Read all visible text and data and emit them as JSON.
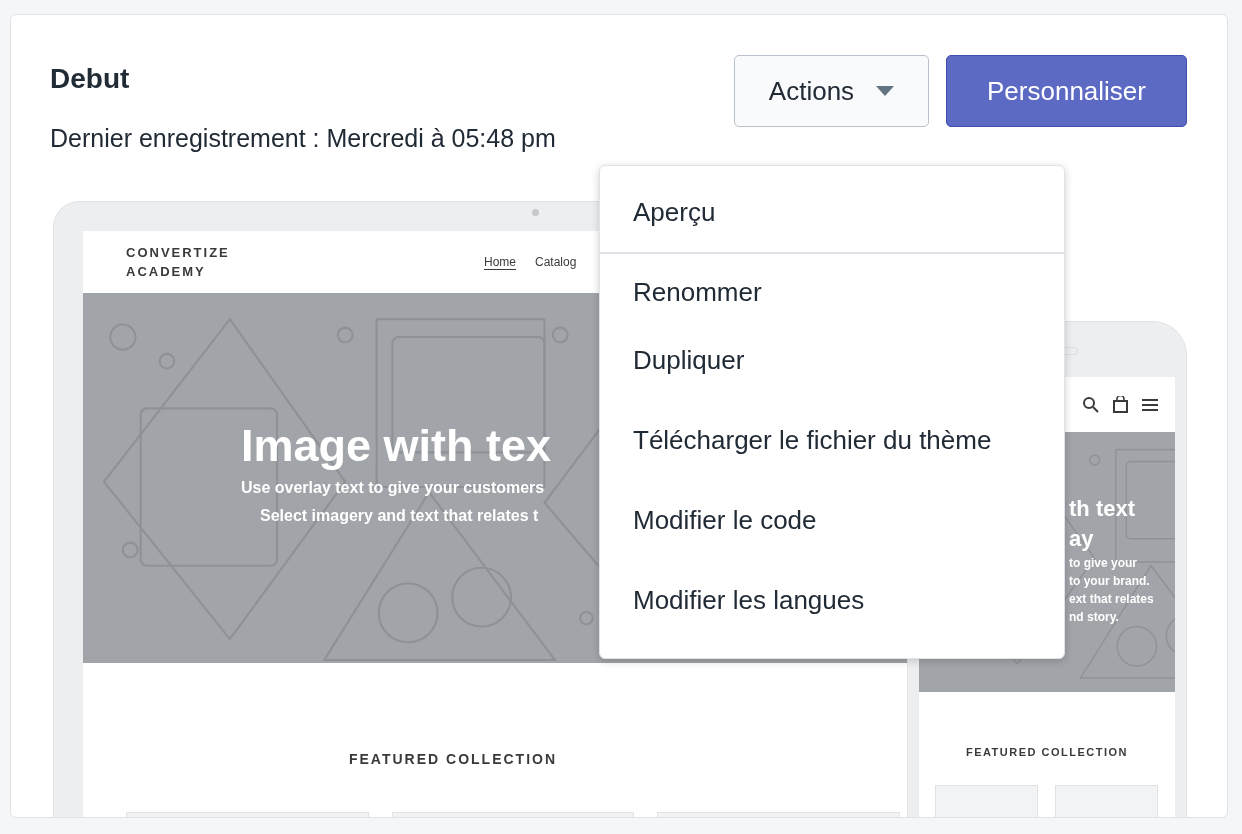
{
  "theme": {
    "title": "Debut",
    "saved": "Dernier enregistrement : Mercredi à 05:48 pm"
  },
  "actions": {
    "label": "Actions",
    "expanded": true
  },
  "primary_button": "Personnaliser",
  "menu": {
    "groups": [
      [
        "Aperçu"
      ],
      [
        "Renommer",
        "Dupliquer",
        "Télécharger le fichier du thème",
        "Modifier le code",
        "Modifier les langues"
      ]
    ]
  },
  "preview": {
    "desktop": {
      "logo": "CONVERTIZE ACADEMY",
      "nav": [
        {
          "label": "Home",
          "selected": true
        },
        {
          "label": "Catalog",
          "selected": false
        }
      ],
      "hero": {
        "title": "Image with tex",
        "lines": [
          "Use overlay text to give your customers",
          "Select imagery and text that relates t"
        ]
      },
      "section_title": "FEATURED COLLECTION"
    },
    "mobile": {
      "hero": {
        "title_lines": [
          "th text",
          "ay"
        ],
        "lines": [
          "to give your",
          "to your brand.",
          "ext that relates",
          "nd story."
        ]
      },
      "section_title": "FEATURED COLLECTION"
    }
  }
}
